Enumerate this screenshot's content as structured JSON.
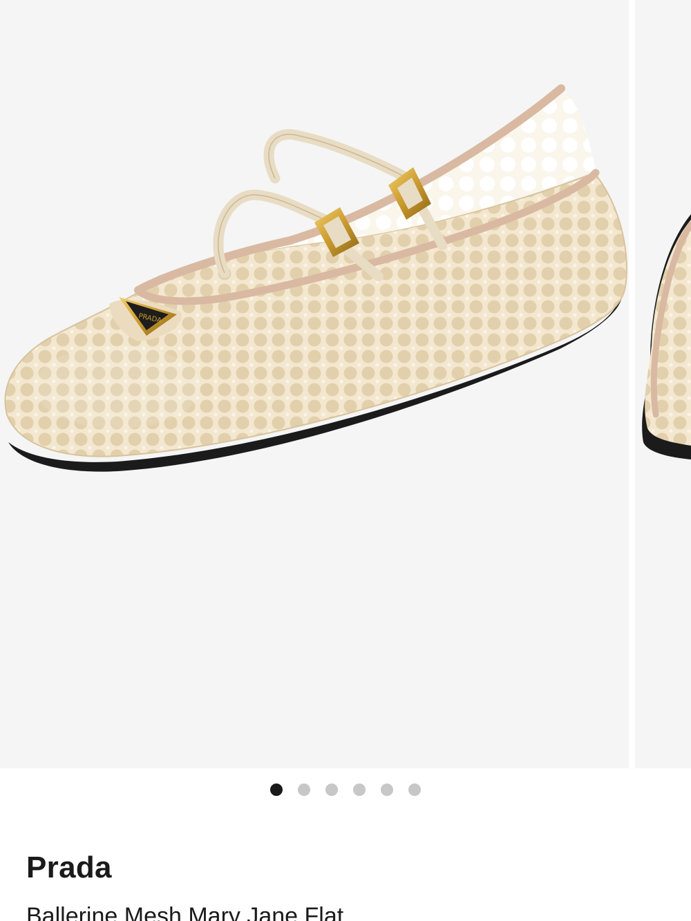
{
  "product": {
    "brand": "Prada",
    "name": "Ballerine Mesh Mary Jane Flat",
    "logo_text": "PRADA"
  },
  "carousel": {
    "total_images": 6,
    "active_index": 0,
    "dots": [
      {
        "active": true
      },
      {
        "active": false
      },
      {
        "active": false
      },
      {
        "active": false
      },
      {
        "active": false
      },
      {
        "active": false
      }
    ]
  },
  "colors": {
    "background": "#ffffff",
    "image_background": "#f5f5f5",
    "shoe_mesh": "#efe2c8",
    "shoe_trim": "#d9b9a2",
    "hardware_gold": "#c99a2e",
    "sole": "#1b1b1b",
    "dot_active": "#1a1a1a",
    "dot_inactive": "#c7c7c7"
  }
}
